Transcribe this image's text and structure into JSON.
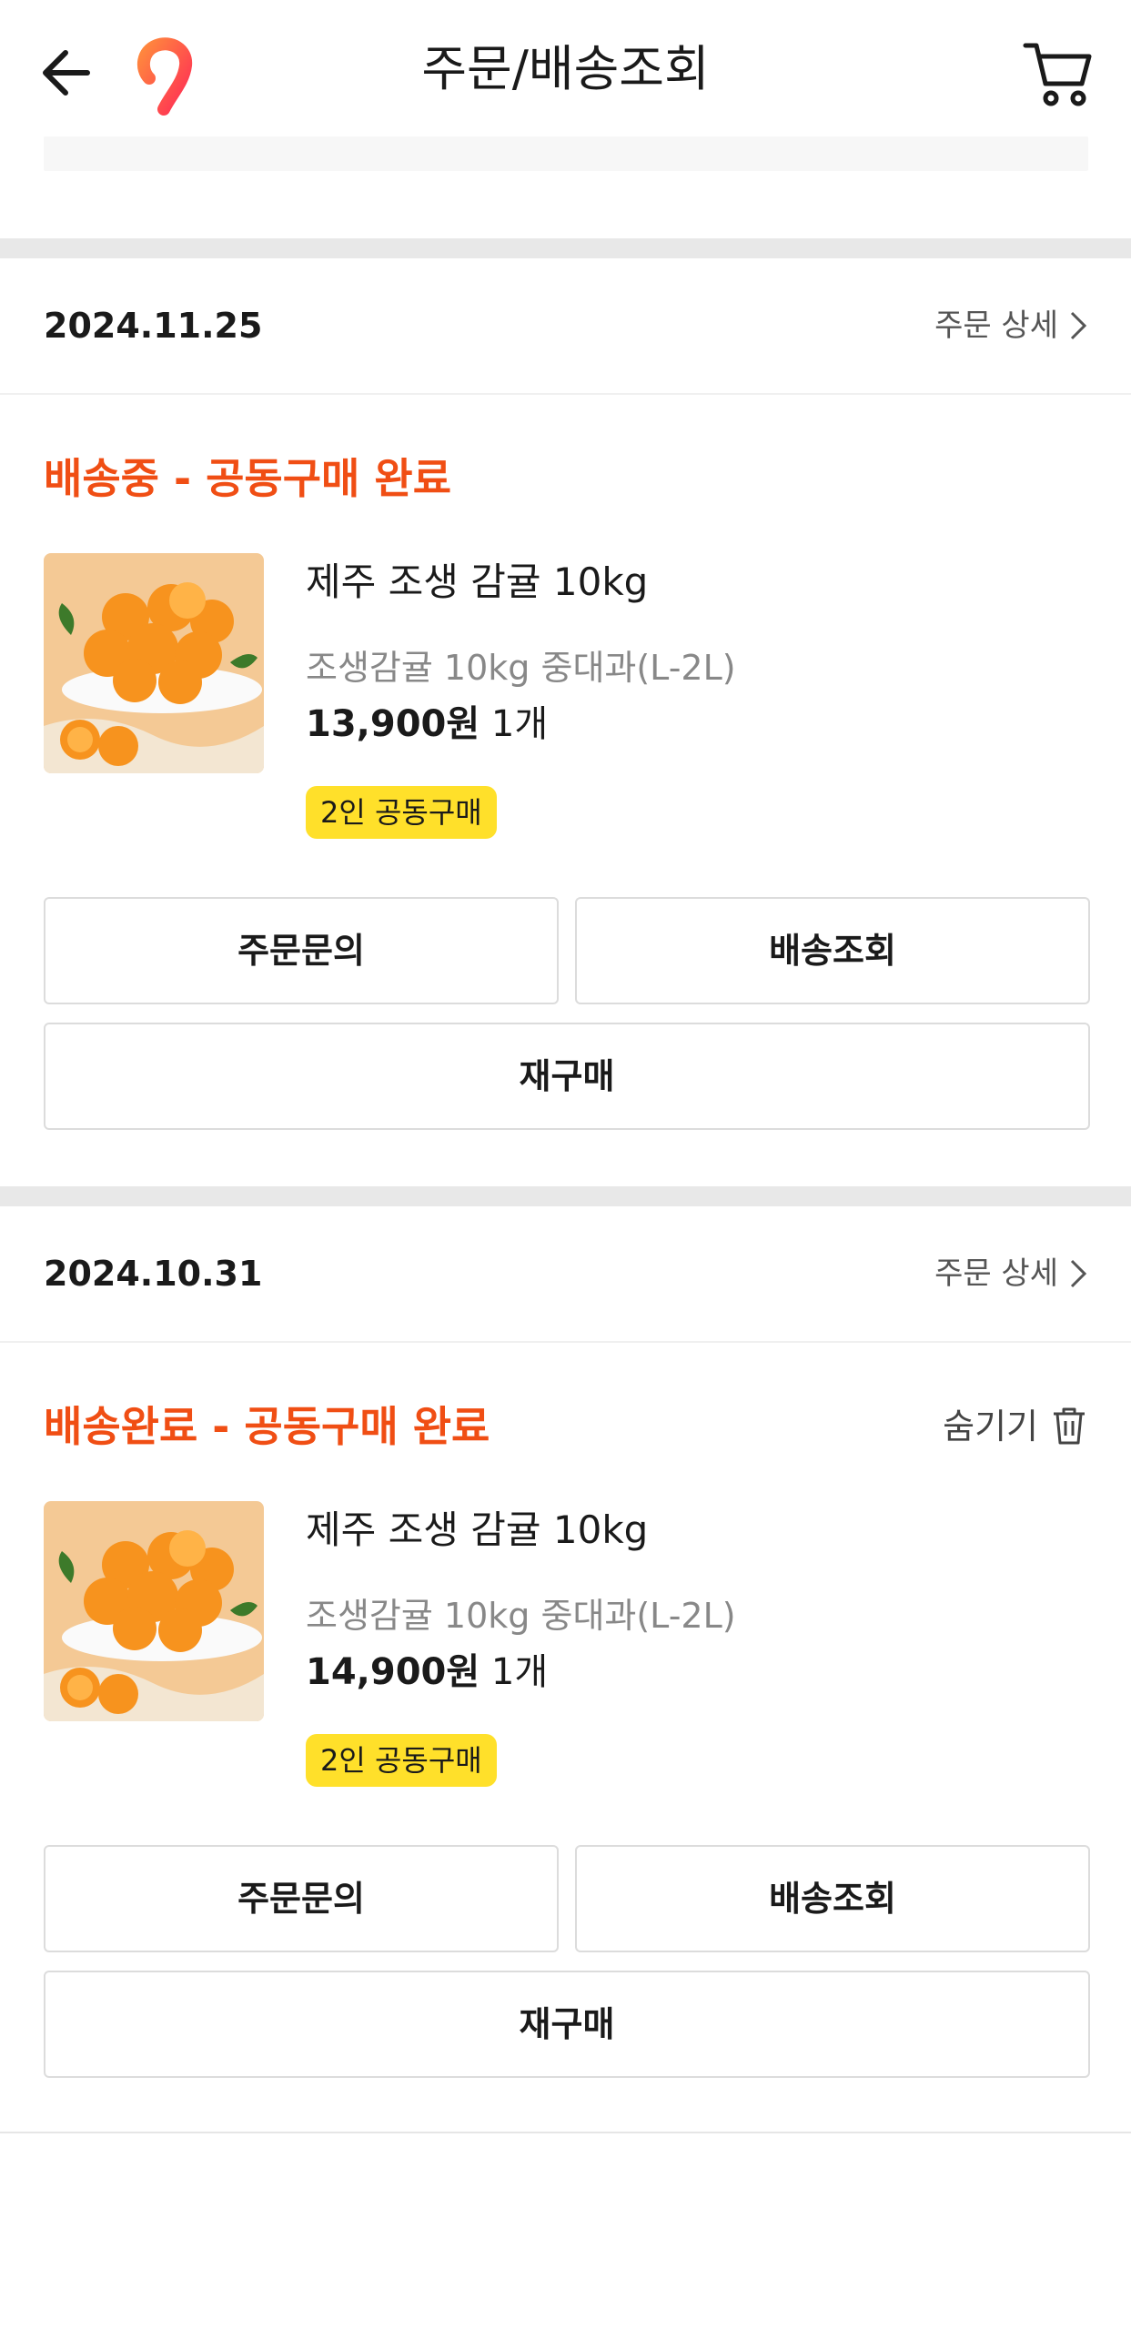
{
  "header": {
    "title": "주문/배송조회",
    "icons": {
      "back": "arrow-left-icon",
      "logo": "brand-logo",
      "cart": "cart-icon"
    },
    "brand_color": "#f04e14"
  },
  "orders": [
    {
      "date": "2024.11.25",
      "detail_label": "주문 상세",
      "status": "배송중 - 공동구매 완료",
      "product_name": "제주 조생 감귤 10kg",
      "product_option": "조생감귤 10kg 중대과(L-2L)",
      "price": "13,900원",
      "qty": "1개",
      "badge": "2인 공동구매",
      "buttons": {
        "inquiry": "주문문의",
        "tracking": "배송조회",
        "reorder": "재구매"
      }
    },
    {
      "date": "2024.10.31",
      "detail_label": "주문 상세",
      "status": "배송완료 - 공동구매 완료",
      "hide_label": "숨기기",
      "product_name": "제주 조생 감귤 10kg",
      "product_option": "조생감귤 10kg 중대과(L-2L)",
      "price": "14,900원",
      "qty": "1개",
      "badge": "2인 공동구매",
      "buttons": {
        "inquiry": "주문문의",
        "tracking": "배송조회",
        "reorder": "재구매"
      }
    }
  ],
  "colors": {
    "status": "#f04e14",
    "badge": "#ffe02a",
    "divider": "#e8e8e8"
  }
}
